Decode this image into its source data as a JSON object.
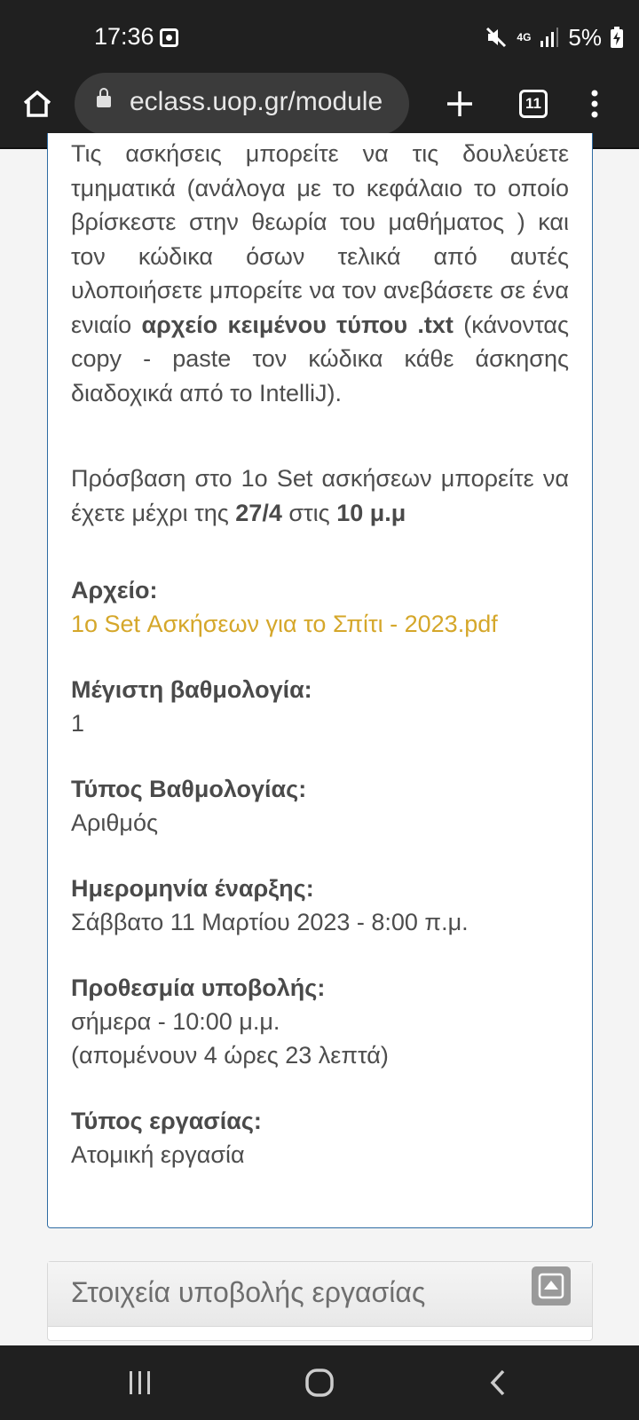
{
  "status_bar": {
    "time": "17:36",
    "network": "4G",
    "battery": "5%"
  },
  "browser": {
    "url": "eclass.uop.gr/module",
    "tab_count": "11"
  },
  "content": {
    "para1_part1": "Τις ασκήσεις μπορείτε να τις δουλεύετε τμηματικά (ανάλογα με το κεφάλαιο το οποίο βρίσκεστε στην θεωρία του μαθήματος ) και τον κώδικα όσων τελικά από αυτές υλοποιήσετε μπορείτε να τον ανεβάσετε σε ένα ενιαίο ",
    "para1_bold": "αρχείο κειμένου τύπου .txt",
    "para1_part2": " (κάνοντας copy - paste τον κώδικα κάθε άσκησης διαδοχικά από το IntelliJ).",
    "para2_part1": "Πρόσβαση στο 1ο Set ασκήσεων μπορείτε να έχετε μέχρι της ",
    "para2_date": "27/4",
    "para2_mid": " στις ",
    "para2_time": "10 μ.μ"
  },
  "fields": {
    "file_label": "Αρχείο:",
    "file_link": "1ο Set Ασκήσεων για το Σπίτι - 2023.pdf",
    "max_grade_label": "Μέγιστη βαθμολογία:",
    "max_grade_value": "1",
    "grade_type_label": "Τύπος Βαθμολογίας:",
    "grade_type_value": "Αριθμός",
    "start_date_label": "Ημερομηνία έναρξης:",
    "start_date_value": "Σάββατο 11 Μαρτίου 2023 - 8:00 π.μ.",
    "deadline_label": "Προθεσμία υποβολής:",
    "deadline_value": "σήμερα - 10:00 μ.μ.",
    "deadline_remaining": "(απομένουν 4 ώρες 23 λεπτά)",
    "work_type_label": "Τύπος εργασίας:",
    "work_type_value": "Ατομική εργασία"
  },
  "submission_panel": {
    "title": "Στοιχεία υποβολής εργασίας"
  },
  "colors": {
    "link": "#d5a72a",
    "panel_border": "#2f6ca3",
    "system_bar": "#202020"
  }
}
